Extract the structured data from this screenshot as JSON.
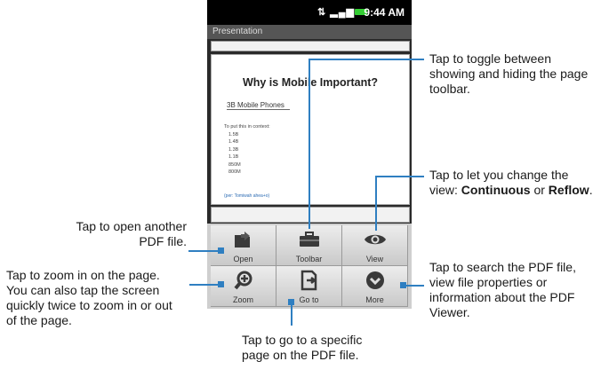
{
  "phone": {
    "status_time": "9:44 AM",
    "app_title": "Presentation"
  },
  "document": {
    "title": "Why is Mobile Important?",
    "subtitle": "3B Mobile Phones",
    "intro": "To put this in context:",
    "list": [
      "1.5B",
      "1.4B",
      "1.3B",
      "1.1B",
      "850M",
      "800M"
    ],
    "link": "(per: Tomiwah ahea+o)"
  },
  "toolbar": {
    "buttons": [
      {
        "label": "Open",
        "icon": "open-folder-icon"
      },
      {
        "label": "Toolbar",
        "icon": "toolbox-icon"
      },
      {
        "label": "View",
        "icon": "eye-icon"
      },
      {
        "label": "Zoom",
        "icon": "zoom-in-icon"
      },
      {
        "label": "Go to",
        "icon": "go-to-page-icon"
      },
      {
        "label": "More",
        "icon": "more-chevron-icon"
      }
    ]
  },
  "callouts": {
    "toggle": "Tap to toggle between showing and hiding the page toolbar.",
    "view_pre": "Tap to let you change the view: ",
    "view_b1": "Continuous",
    "view_mid": " or ",
    "view_b2": "Reflow",
    "view_post": ".",
    "open": "Tap to open another PDF file.",
    "zoom": "Tap to zoom in on the page. You can also tap the screen quickly twice to zoom in or out of the page.",
    "more": "Tap to search the PDF file, view file properties or information about the PDF Viewer.",
    "goto": "Tap to go to a specific page on the PDF file."
  },
  "colors": {
    "leader_line": "#2f7fc1"
  }
}
